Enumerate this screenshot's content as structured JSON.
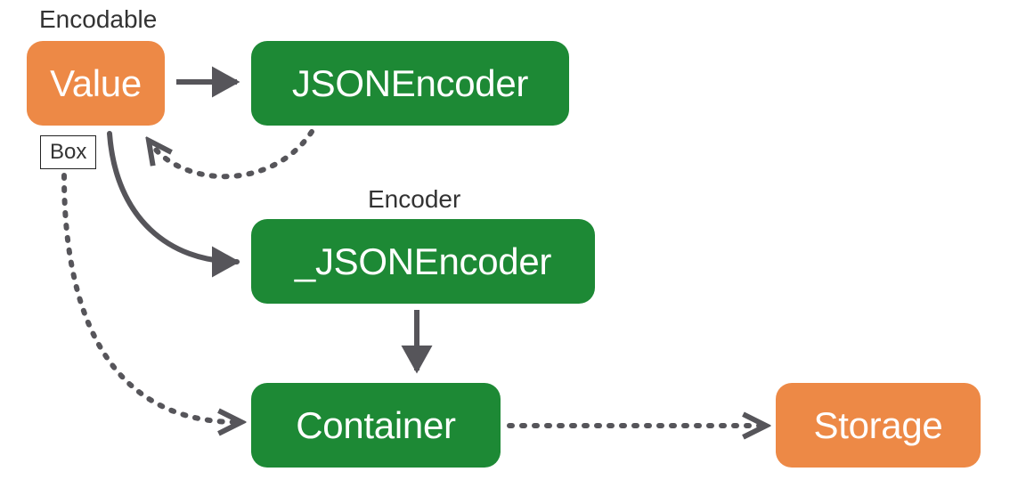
{
  "diagram": {
    "annotations": {
      "encodable": "Encodable",
      "encoder": "Encoder",
      "box": "Box"
    },
    "nodes": {
      "value": "Value",
      "jsonEncoder": "JSONEncoder",
      "privJsonEncoder": "_JSONEncoder",
      "container": "Container",
      "storage": "Storage"
    },
    "colors": {
      "orange": "#ED8946",
      "green": "#1D8935",
      "arrow": "#56555A"
    },
    "edges": [
      {
        "from": "value",
        "to": "jsonEncoder",
        "style": "solid"
      },
      {
        "from": "jsonEncoder",
        "to": "value",
        "style": "dotted",
        "note": "curved back"
      },
      {
        "from": "value",
        "to": "privJsonEncoder",
        "style": "solid",
        "note": "curved"
      },
      {
        "from": "privJsonEncoder",
        "to": "container",
        "style": "solid"
      },
      {
        "from": "box",
        "to": "container",
        "style": "dotted",
        "note": "curved"
      },
      {
        "from": "container",
        "to": "storage",
        "style": "dotted"
      }
    ]
  }
}
